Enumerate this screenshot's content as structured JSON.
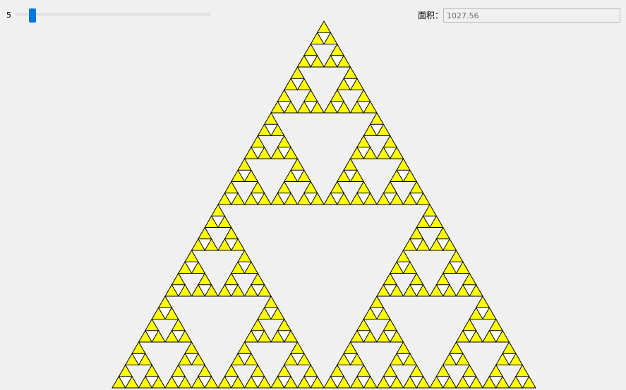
{
  "controls": {
    "level_value": "5",
    "level_fraction": 0.04,
    "area_label": "面积：",
    "area_value": "1027.56"
  },
  "colors": {
    "background": "#f0f0f0",
    "fill": "#ffff00",
    "stroke": "#000000",
    "thumb": "#0078d7"
  },
  "fractal": {
    "depth": 5
  }
}
